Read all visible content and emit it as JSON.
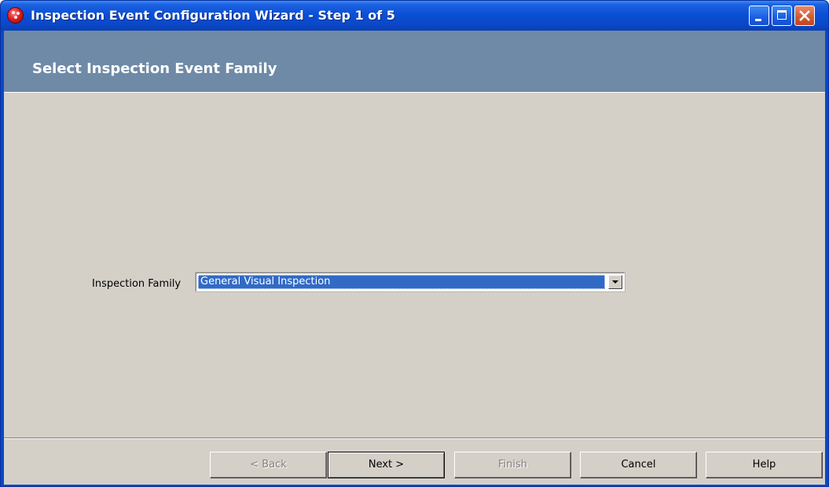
{
  "window": {
    "title": "Inspection Event Configuration Wizard - Step 1 of 5",
    "controls": [
      "minimize",
      "maximize",
      "close"
    ]
  },
  "header": {
    "title": "Select Inspection Event Family"
  },
  "form": {
    "inspection_family_label": "Inspection Family",
    "inspection_family_value": "General Visual Inspection"
  },
  "footer": {
    "back_label": "< Back",
    "back_enabled": false,
    "next_label": "Next >",
    "finish_label": "Finish",
    "finish_enabled": false,
    "cancel_label": "Cancel",
    "help_label": "Help"
  },
  "colors": {
    "title_bar": "#0a48c8",
    "header_band": "#6e8aa6",
    "dialog_background": "#d4d0c8",
    "selection": "#316ac5"
  }
}
